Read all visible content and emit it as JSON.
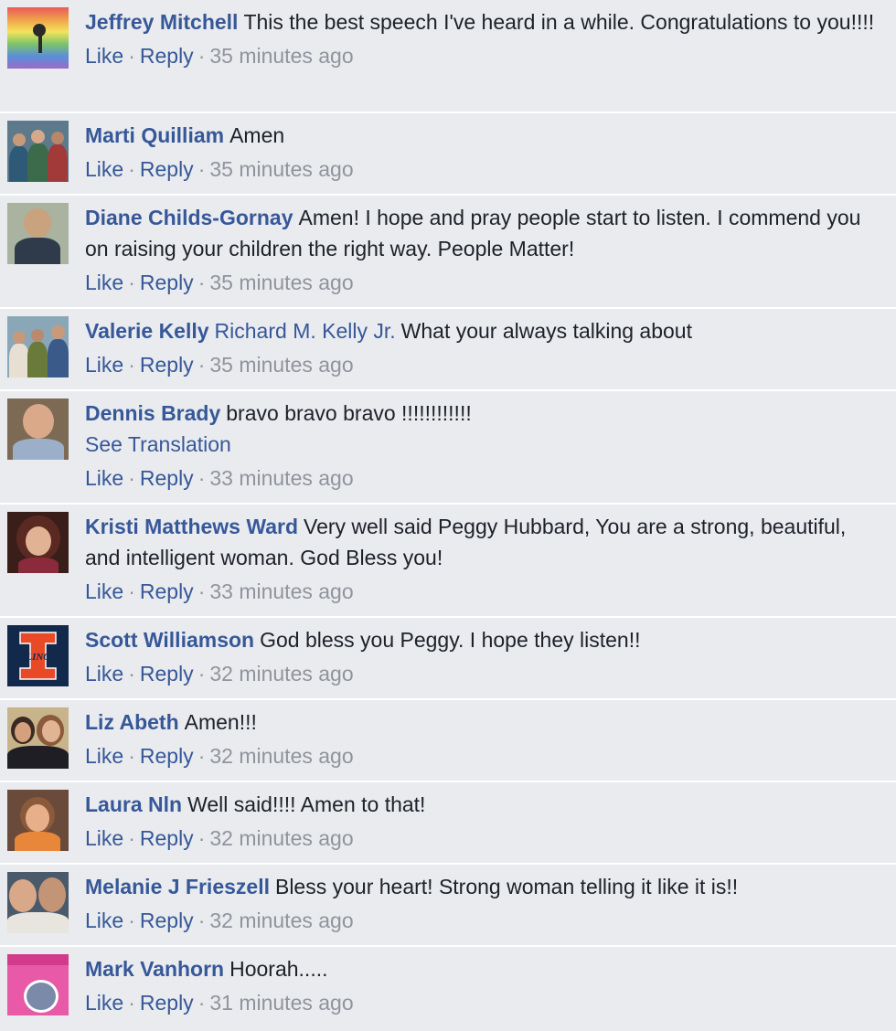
{
  "comments": [
    {
      "author": "Jeffrey Mitchell",
      "text": "This the best speech I've heard in a while. Congratulations to you!!!!",
      "like": "Like",
      "reply": "Reply",
      "time": "35 minutes ago"
    },
    {
      "author": "Marti Quilliam",
      "text": "Amen",
      "like": "Like",
      "reply": "Reply",
      "time": "35 minutes ago"
    },
    {
      "author": "Diane Childs-Gornay",
      "text": "Amen! I hope and pray people start to listen. I commend you on raising your children the right way. People Matter!",
      "like": "Like",
      "reply": "Reply",
      "time": "35 minutes ago"
    },
    {
      "author": "Valerie Kelly",
      "mention": "Richard M. Kelly Jr.",
      "text": "What your always talking about",
      "like": "Like",
      "reply": "Reply",
      "time": "35 minutes ago"
    },
    {
      "author": "Dennis Brady",
      "text": "bravo bravo bravo !!!!!!!!!!!!",
      "see_translation": "See Translation",
      "like": "Like",
      "reply": "Reply",
      "time": "33 minutes ago"
    },
    {
      "author": "Kristi Matthews Ward",
      "text": "Very well said Peggy Hubbard, You are a strong, beautiful, and intelligent woman. God Bless you!",
      "like": "Like",
      "reply": "Reply",
      "time": "33 minutes ago"
    },
    {
      "author": "Scott Williamson",
      "text": "God bless you Peggy. I hope they listen!!",
      "like": "Like",
      "reply": "Reply",
      "time": "32 minutes ago"
    },
    {
      "author": "Liz Abeth",
      "text": "Amen!!!",
      "like": "Like",
      "reply": "Reply",
      "time": "32 minutes ago"
    },
    {
      "author": "Laura Nln",
      "text": "Well said!!!! Amen to that!",
      "like": "Like",
      "reply": "Reply",
      "time": "32 minutes ago"
    },
    {
      "author": "Melanie J Frieszell",
      "text": "Bless your heart! Strong woman telling it like it is!!",
      "like": "Like",
      "reply": "Reply",
      "time": "32 minutes ago"
    },
    {
      "author": "Mark Vanhorn",
      "text": "Hoorah.....",
      "like": "Like",
      "reply": "Reply",
      "time": "31 minutes ago"
    }
  ],
  "avatar_logo_text": "ILLINOIS",
  "colors": {
    "background": "#e9ebee",
    "link": "#365899",
    "text": "#1d2129",
    "meta": "#90949c"
  }
}
